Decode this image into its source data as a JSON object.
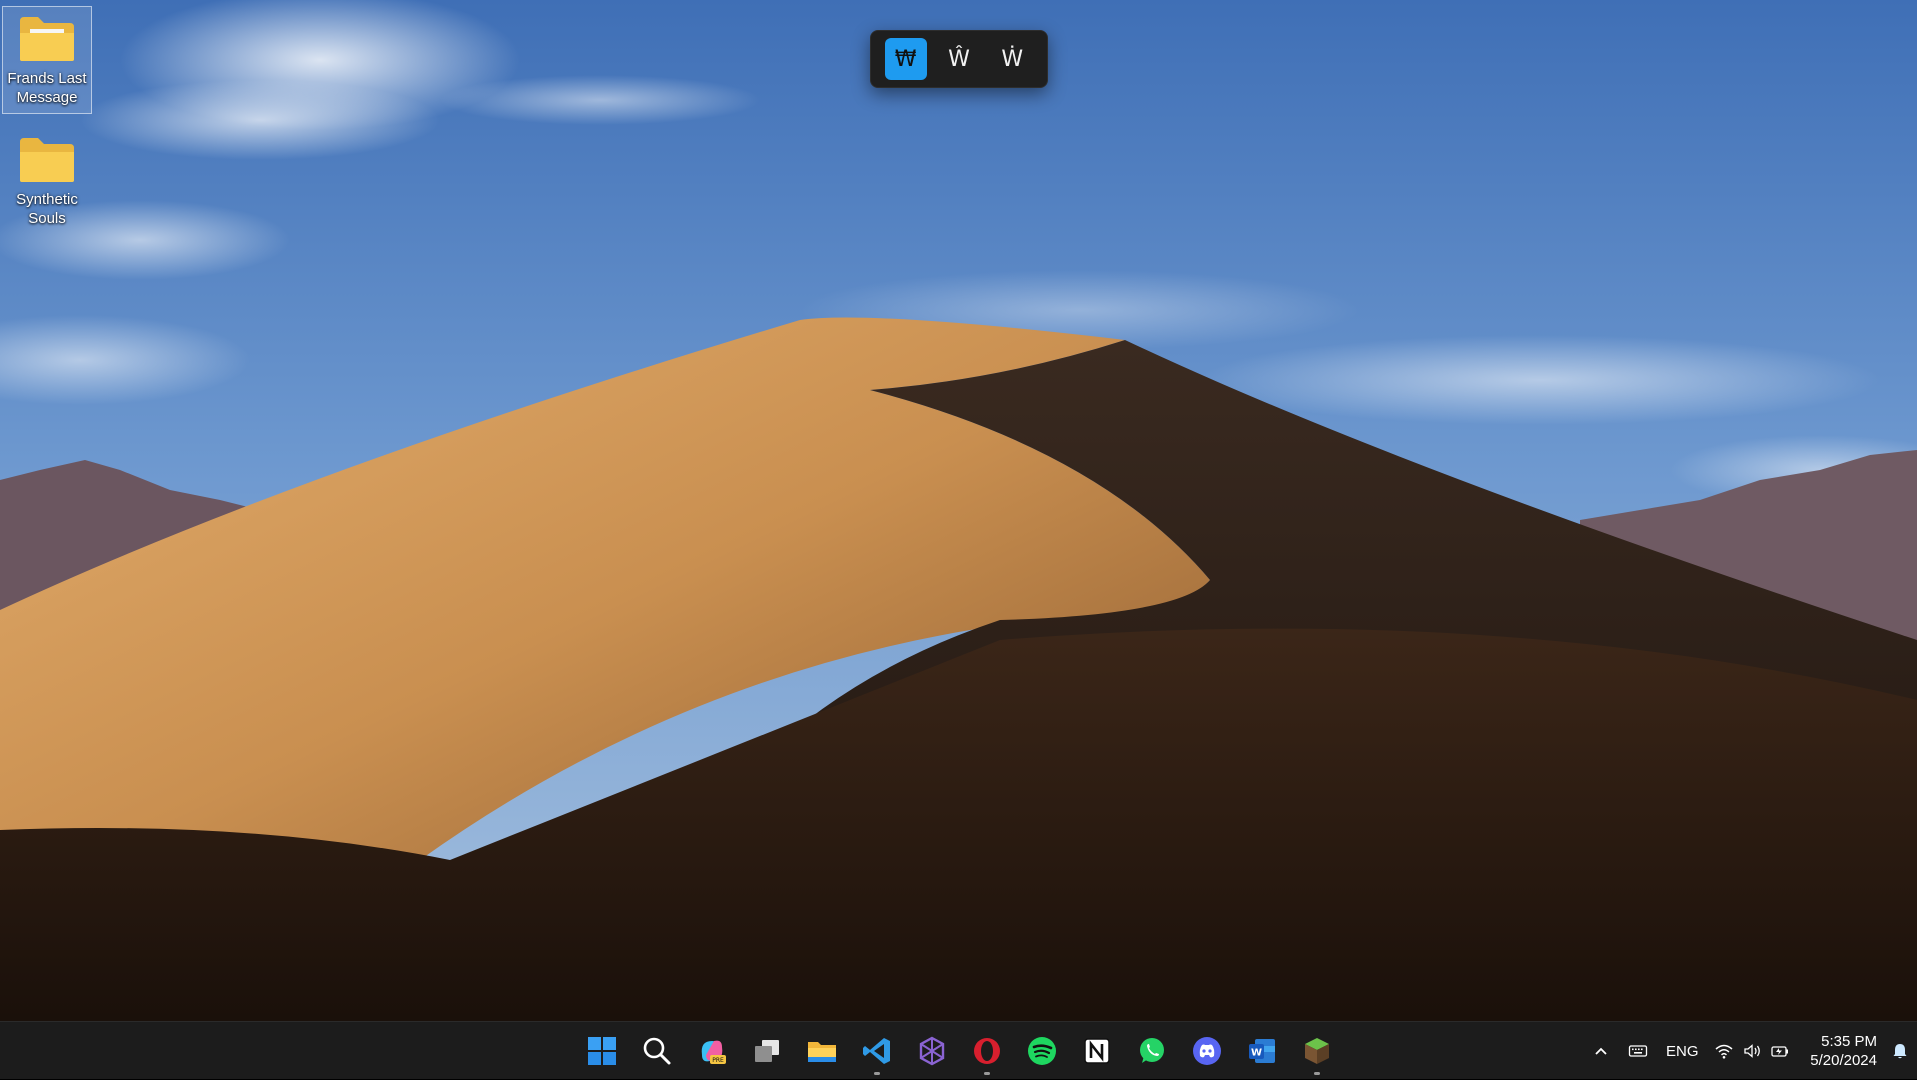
{
  "desktop": {
    "icons": [
      {
        "label": "Frands Last Message",
        "selected": true
      },
      {
        "label": "Synthetic Souls",
        "selected": false
      }
    ]
  },
  "accent_popup": {
    "options": [
      "₩",
      "Ŵ",
      "Ẇ"
    ],
    "selected_index": 0
  },
  "taskbar": {
    "apps": [
      {
        "icon": "windows-start-icon",
        "running": false
      },
      {
        "icon": "search-icon",
        "running": false
      },
      {
        "icon": "copilot-pre-icon",
        "running": false
      },
      {
        "icon": "task-view-icon",
        "running": false
      },
      {
        "icon": "file-explorer-icon",
        "running": false
      },
      {
        "icon": "vscode-icon",
        "running": true
      },
      {
        "icon": "obsidian-like-icon",
        "running": false
      },
      {
        "icon": "opera-icon",
        "running": true
      },
      {
        "icon": "spotify-icon",
        "running": false
      },
      {
        "icon": "notion-icon",
        "running": false
      },
      {
        "icon": "whatsapp-icon",
        "running": false
      },
      {
        "icon": "discord-icon",
        "running": false
      },
      {
        "icon": "word-icon",
        "running": false
      },
      {
        "icon": "minecraft-icon",
        "running": true
      }
    ],
    "tray": {
      "language": "ENG",
      "time": "5:35 PM",
      "date": "5/20/2024"
    }
  },
  "colors": {
    "accent": "#1e9bf0",
    "taskbar": "#1c1c1c",
    "popup": "#1f1f1f"
  }
}
